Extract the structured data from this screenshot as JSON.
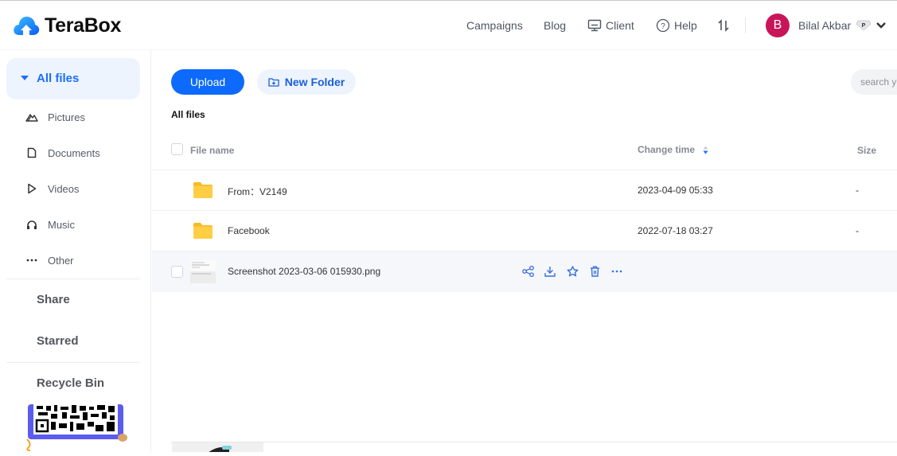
{
  "app": {
    "name": "TeraBox"
  },
  "header": {
    "nav": [
      {
        "label": "Campaigns",
        "icon": null
      },
      {
        "label": "Blog",
        "icon": null
      },
      {
        "label": "Client",
        "icon": "monitor-icon"
      },
      {
        "label": "Help",
        "icon": "help-circle-icon"
      }
    ],
    "transfer_icon": "transfer-arrows-icon",
    "user": {
      "initial": "B",
      "name": "Bilal Akbar",
      "badge": "P",
      "avatar_color": "#c8155a"
    }
  },
  "sidebar": {
    "all_files": "All files",
    "categories": [
      {
        "label": "Pictures",
        "icon": "mountain-icon"
      },
      {
        "label": "Documents",
        "icon": "document-icon"
      },
      {
        "label": "Videos",
        "icon": "play-icon"
      },
      {
        "label": "Music",
        "icon": "headphones-icon"
      },
      {
        "label": "Other",
        "icon": "more-dots-icon"
      }
    ],
    "share": "Share",
    "starred": "Starred",
    "recycle_bin": "Recycle Bin"
  },
  "toolbar": {
    "upload_label": "Upload",
    "new_folder_label": "New Folder",
    "search_placeholder": "search your files"
  },
  "breadcrumb": "All files",
  "table": {
    "headers": {
      "name": "File name",
      "time": "Change time",
      "size": "Size"
    },
    "rows": [
      {
        "type": "folder",
        "name": "From：V2149",
        "time": "2023-04-09 05:33",
        "size": "-"
      },
      {
        "type": "folder",
        "name": "Facebook",
        "time": "2022-07-18 03:27",
        "size": "-"
      },
      {
        "type": "image",
        "name": "Screenshot 2023-03-06 015930.png",
        "time": "",
        "size": "",
        "actions": [
          "share",
          "download",
          "star",
          "delete",
          "more"
        ]
      }
    ]
  },
  "colors": {
    "accent": "#0d6afc",
    "accent_light": "#eef4fe",
    "folder": "#ffc83d"
  }
}
